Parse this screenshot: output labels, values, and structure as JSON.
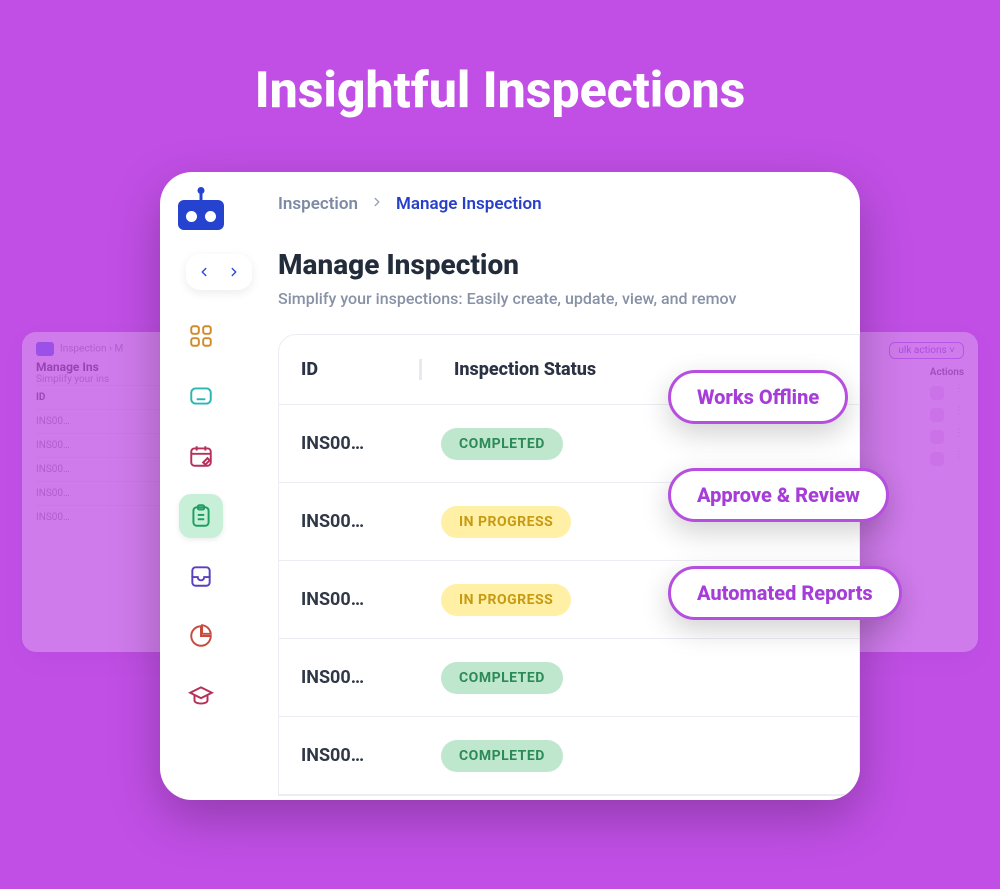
{
  "hero": {
    "title": "Insightful Inspections"
  },
  "breadcrumb": {
    "root": "Inspection",
    "current": "Manage Inspection"
  },
  "page": {
    "title": "Manage Inspection",
    "subtitle": "Simplify your inspections: Easily create, update, view, and remov"
  },
  "table": {
    "headers": {
      "id": "ID",
      "status": "Inspection Status"
    },
    "rows": [
      {
        "id": "INS00…",
        "status": "COMPLETED",
        "status_type": "completed"
      },
      {
        "id": "INS00…",
        "status": "IN PROGRESS",
        "status_type": "inprogress"
      },
      {
        "id": "INS00…",
        "status": "IN PROGRESS",
        "status_type": "inprogress"
      },
      {
        "id": "INS00…",
        "status": "COMPLETED",
        "status_type": "completed"
      },
      {
        "id": "INS00…",
        "status": "COMPLETED",
        "status_type": "completed"
      }
    ]
  },
  "features": {
    "offline": "Works Offline",
    "approve": "Approve & Review",
    "reports": "Automated Reports"
  },
  "bg": {
    "left": {
      "crumb": "Inspection  ›  M",
      "title": "Manage Ins",
      "sub": "Simplify your ins",
      "col": "ID",
      "rows": [
        "INS00…",
        "INS00…",
        "INS00…",
        "INS00…",
        "INS00…"
      ]
    },
    "right": {
      "bulk": "ulk actions ˅",
      "actions": "Actions"
    }
  }
}
